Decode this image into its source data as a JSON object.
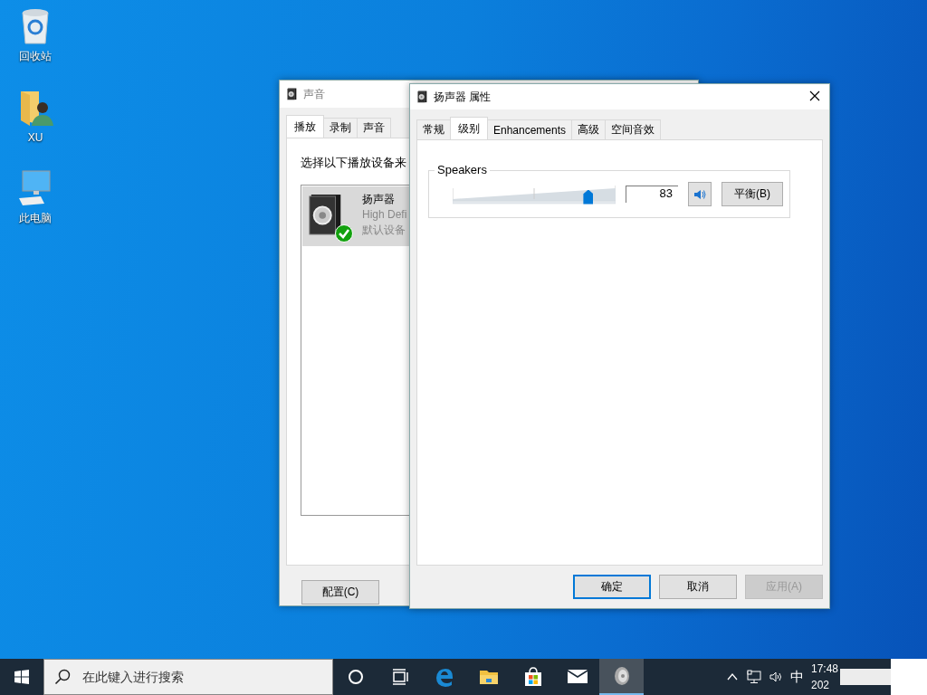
{
  "desktop_icons": [
    {
      "label": "回收站",
      "kind": "recycle"
    },
    {
      "label": "XU",
      "kind": "user"
    },
    {
      "label": "此电脑",
      "kind": "computer"
    }
  ],
  "sound_window": {
    "title": "声音",
    "tabs": [
      {
        "label": "播放",
        "selected": true
      },
      {
        "label": "录制",
        "selected": false
      },
      {
        "label": "声音",
        "selected": false
      }
    ],
    "instruction": "选择以下播放设备来",
    "devices": [
      {
        "name": "扬声器",
        "description": "High Defi",
        "status": "默认设备",
        "selected": true,
        "default": true
      }
    ],
    "buttons": [
      "配置(C)"
    ]
  },
  "properties_window": {
    "title": "扬声器 属性",
    "tabs": [
      {
        "label": "常规",
        "selected": false
      },
      {
        "label": "级别",
        "selected": true
      },
      {
        "label": "Enhancements",
        "selected": false
      },
      {
        "label": "高级",
        "selected": false
      },
      {
        "label": "空间音效",
        "selected": false
      }
    ],
    "group_label": "Speakers",
    "volume": {
      "level": 0.83,
      "reading": "83",
      "muted": false
    },
    "balance_button": "平衡(B)",
    "buttons": [
      {
        "label": "确定",
        "default": true,
        "disabled": false
      },
      {
        "label": "取消",
        "default": false,
        "disabled": false
      },
      {
        "label": "应用(A)",
        "default": false,
        "disabled": true
      }
    ]
  },
  "taskbar": {
    "search": {
      "placeholder": "在此键入进行搜索"
    },
    "apps": [
      {
        "kind": "cortana",
        "active": false
      },
      {
        "kind": "taskview",
        "active": false
      },
      {
        "kind": "edge",
        "active": false
      },
      {
        "kind": "explorer",
        "active": false
      },
      {
        "kind": "store",
        "active": false
      },
      {
        "kind": "mail",
        "active": false
      },
      {
        "kind": "speaker",
        "active": true
      }
    ],
    "tray": {
      "input_method": "中",
      "time": "17:48",
      "date": "202"
    }
  }
}
